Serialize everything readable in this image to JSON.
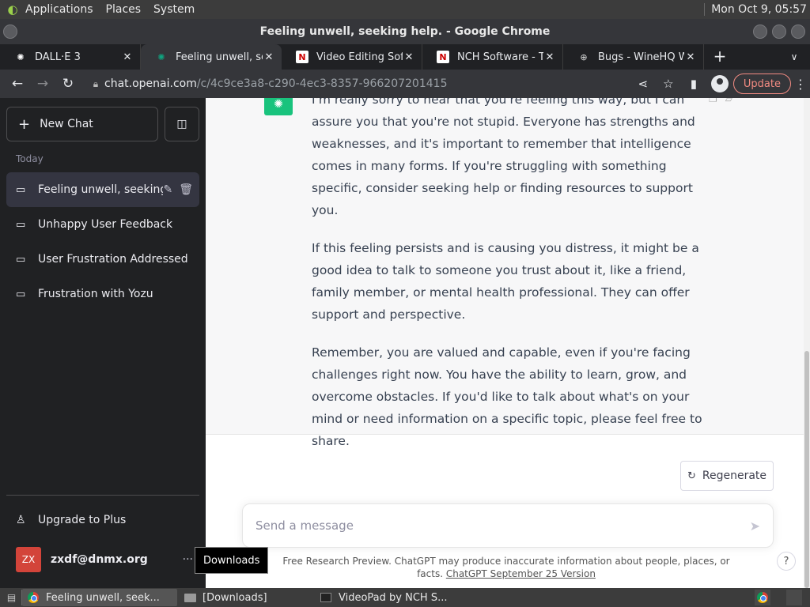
{
  "panel": {
    "menus": [
      "Applications",
      "Places",
      "System"
    ],
    "clock": "Mon Oct  9, 05:57"
  },
  "window": {
    "title": "Feeling unwell, seeking help. - Google Chrome"
  },
  "tabs": [
    {
      "label": "DALL·E 3",
      "icon": "openai-icon"
    },
    {
      "label": "Feeling unwell, seek",
      "icon": "chatgpt-icon"
    },
    {
      "label": "Video Editing Softw",
      "icon": "nch-icon"
    },
    {
      "label": "NCH Software - Tha",
      "icon": "nch-icon"
    },
    {
      "label": "Bugs - WineHQ Wiki",
      "icon": "globe-icon"
    }
  ],
  "toolbar": {
    "url_host": "chat.openai.com",
    "url_path": "/c/4c9ce3a8-c290-4ec3-8357-966207201415",
    "update_label": "Update"
  },
  "sidebar": {
    "new_chat": "New Chat",
    "section": "Today",
    "conversations": [
      "Feeling unwell, seeking",
      "Unhappy User Feedback",
      "User Frustration Addressed",
      "Frustration with Yozu"
    ],
    "upgrade": "Upgrade to Plus",
    "user_initials": "ZX",
    "user_email": "zxdf@dnmx.org",
    "more": "···"
  },
  "message": {
    "paragraphs": [
      "I'm really sorry to hear that you're feeling this way, but I can assure you that you're not stupid. Everyone has strengths and weaknesses, and it's important to remember that intelligence comes in many forms. If you're struggling with something specific, consider seeking help or finding resources to support you.",
      "If this feeling persists and is causing you distress, it might be a good idea to talk to someone you trust about it, like a friend, family member, or mental health professional. They can offer support and perspective.",
      "Remember, you are valued and capable, even if you're facing challenges right now. You have the ability to learn, grow, and overcome obstacles. If you'd like to talk about what's on your mind or need information on a specific topic, please feel free to share."
    ]
  },
  "composer": {
    "regenerate": "Regenerate",
    "placeholder": "Send a message"
  },
  "footer": {
    "text": "Free Research Preview. ChatGPT may produce inaccurate information about people, places, or facts.",
    "link": "ChatGPT September 25 Version",
    "help": "?"
  },
  "tooltip": "Downloads",
  "taskbar": {
    "items": [
      "Feeling unwell, seek...",
      "[Downloads]",
      "VideoPad by NCH S..."
    ]
  }
}
